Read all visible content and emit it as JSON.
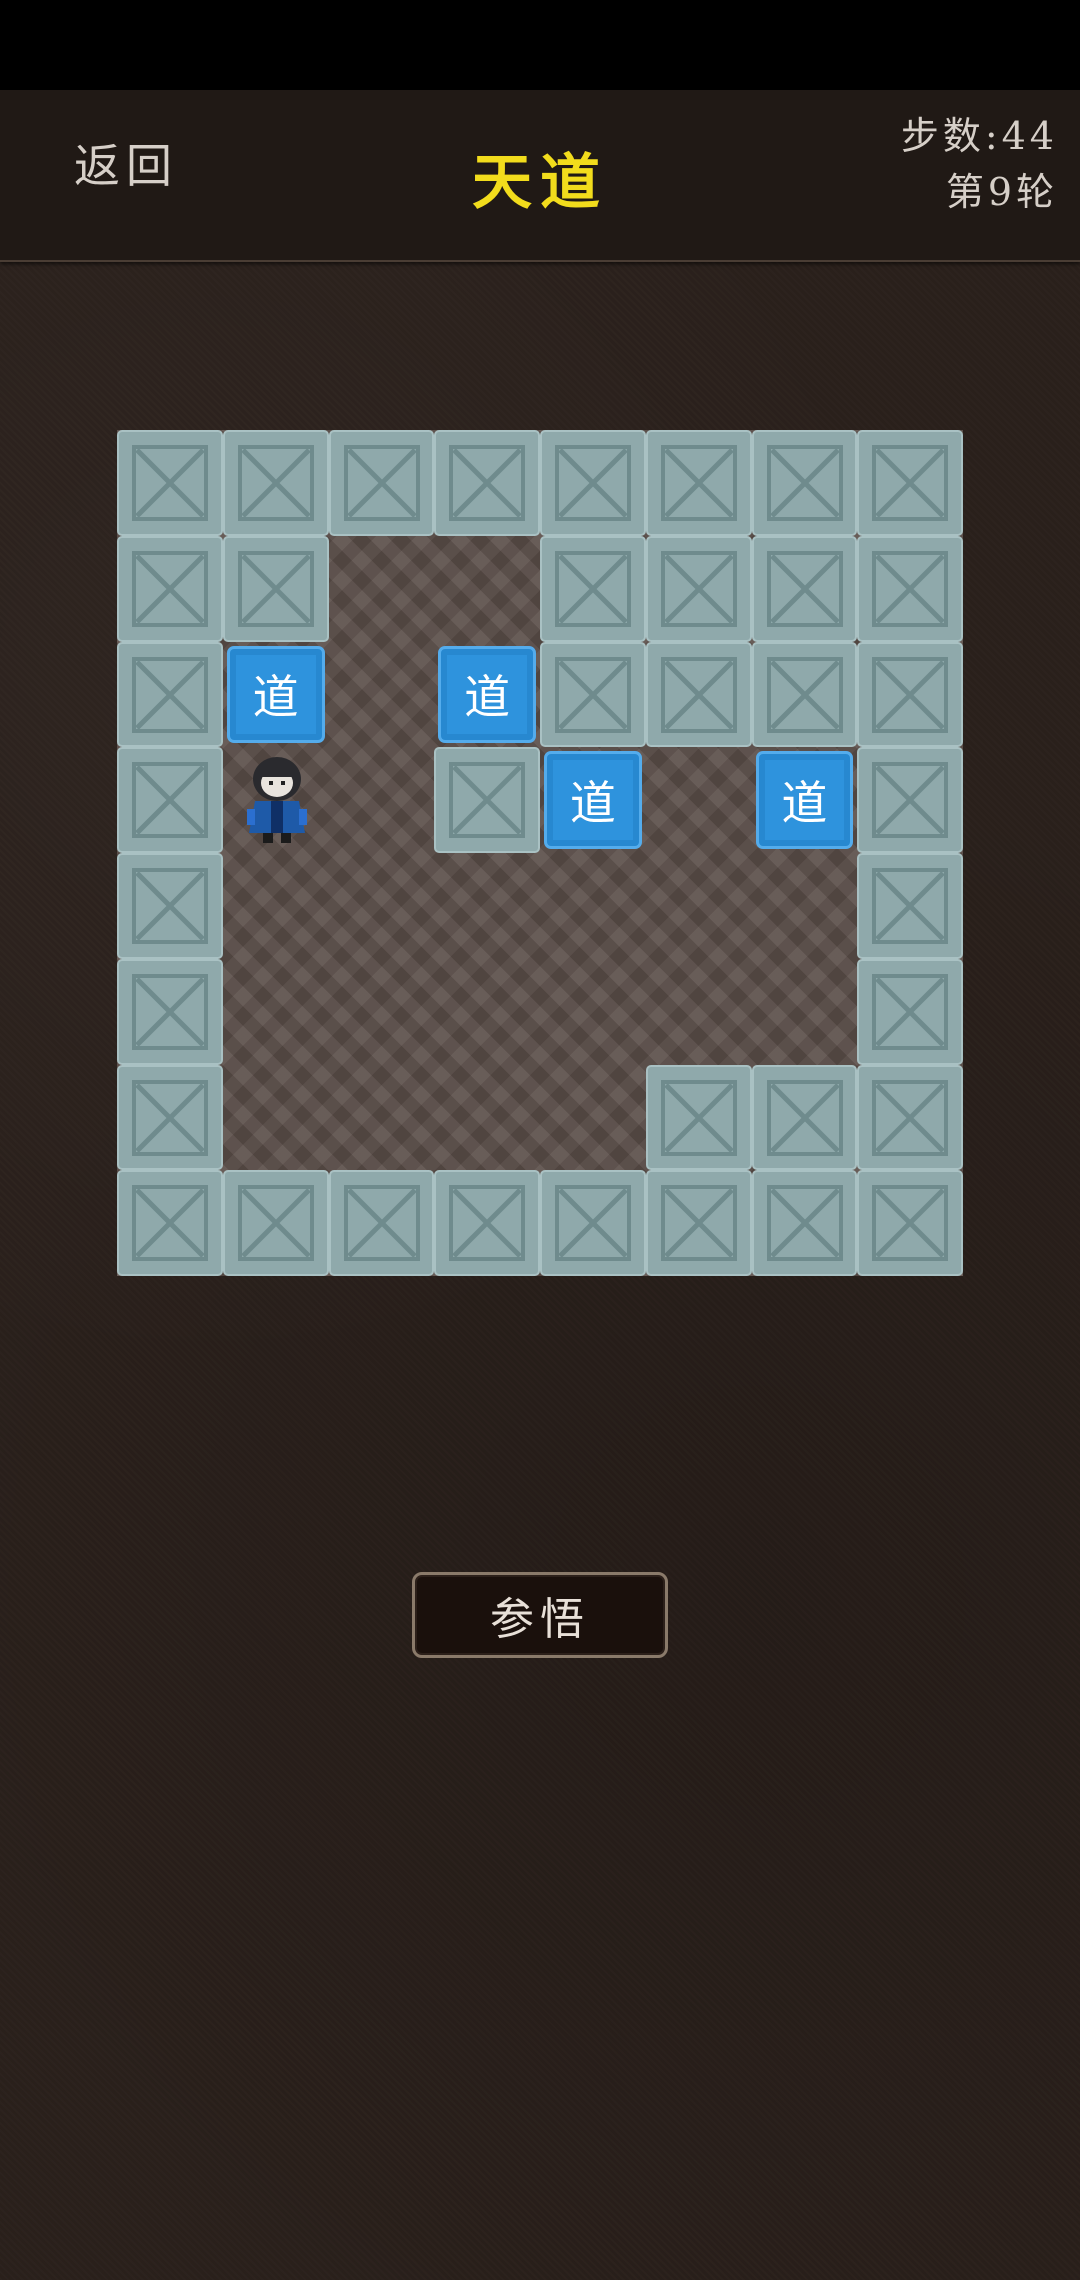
{
  "header": {
    "back_label": "返回",
    "title": "天道",
    "steps_text": "步数:44",
    "round_text": "第9轮"
  },
  "board": {
    "rows": 8,
    "cols": 8,
    "grid": [
      "########",
      "##  ####",
      "#B B####",
      "#P #B B#",
      "#      #",
      "#      #",
      "#    ###",
      "########"
    ],
    "legend": {
      "#": "wall",
      " ": "floor",
      "B": "box",
      "P": "player"
    },
    "box_label": "道",
    "colors": {
      "wall": "#8fa9ab",
      "floor": "#5a4d48",
      "box": "#2e93dd"
    }
  },
  "action": {
    "label": "参悟"
  },
  "colors": {
    "title": "#f2dc1c",
    "background": "#2a201b"
  }
}
